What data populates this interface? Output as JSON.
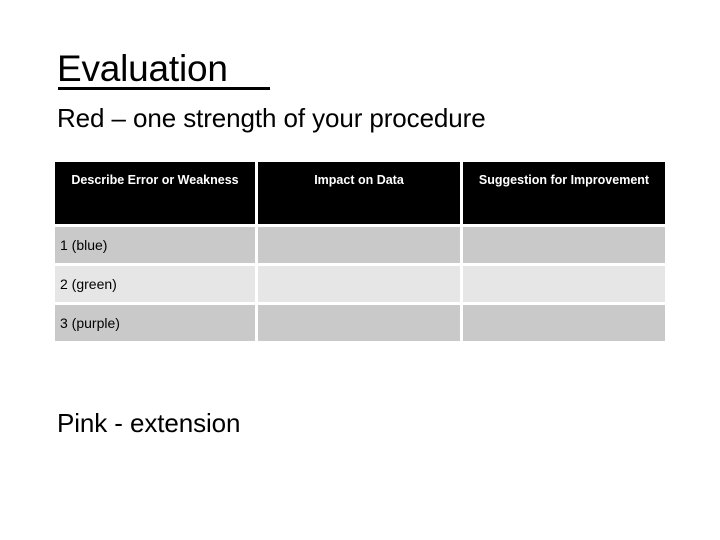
{
  "slide": {
    "title": "Evaluation",
    "subtitle": "Red – one strength of your procedure",
    "footer_note": "Pink - extension",
    "colors": {
      "background": "#ffffff",
      "text": "#000000",
      "header_fill": "#000000",
      "header_text": "#ffffff",
      "row_shade_dark": "#c9c9c9",
      "row_shade_light": "#e6e6e6"
    }
  },
  "table": {
    "columns": [
      {
        "label": "Describe Error or Weakness"
      },
      {
        "label": "Impact on Data"
      },
      {
        "label": "Suggestion for Improvement"
      }
    ],
    "rows": [
      {
        "shade": "dark",
        "cells": [
          "1 (blue)",
          "",
          ""
        ]
      },
      {
        "shade": "light",
        "cells": [
          "2 (green)",
          "",
          ""
        ]
      },
      {
        "shade": "dark",
        "cells": [
          "3 (purple)",
          "",
          ""
        ]
      }
    ]
  }
}
